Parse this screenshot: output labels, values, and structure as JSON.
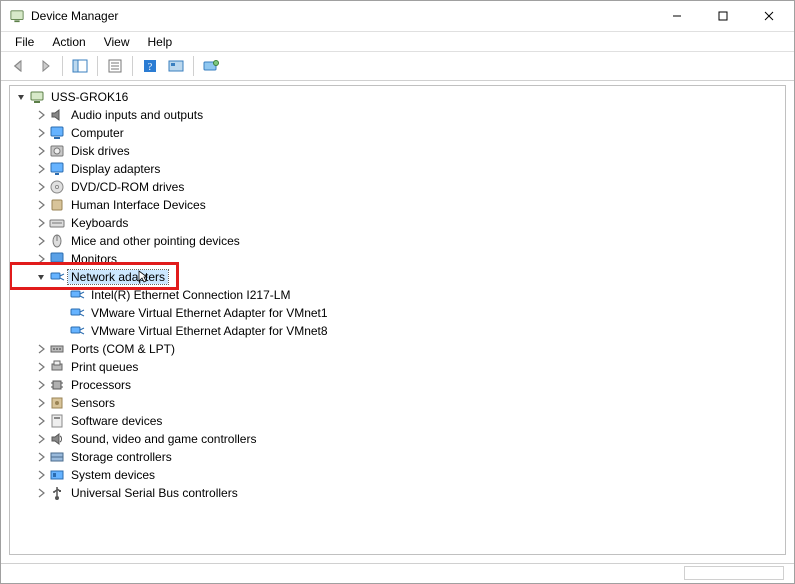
{
  "window": {
    "title": "Device Manager"
  },
  "menu": {
    "file": "File",
    "action": "Action",
    "view": "View",
    "help": "Help"
  },
  "tree": {
    "root": {
      "label": "USS-GROK16",
      "icon": "computer",
      "expanded": true
    },
    "categories": [
      {
        "label": "Audio inputs and outputs",
        "icon": "audio",
        "expanded": false
      },
      {
        "label": "Computer",
        "icon": "computer-monitor",
        "expanded": false
      },
      {
        "label": "Disk drives",
        "icon": "disk",
        "expanded": false
      },
      {
        "label": "Display adapters",
        "icon": "display",
        "expanded": false
      },
      {
        "label": "DVD/CD-ROM drives",
        "icon": "cd",
        "expanded": false
      },
      {
        "label": "Human Interface Devices",
        "icon": "hid",
        "expanded": false
      },
      {
        "label": "Keyboards",
        "icon": "keyboard",
        "expanded": false
      },
      {
        "label": "Mice and other pointing devices",
        "icon": "mouse",
        "expanded": false
      },
      {
        "label": "Monitors",
        "icon": "monitor",
        "expanded": false
      },
      {
        "label": "Network adapters",
        "icon": "network",
        "expanded": true,
        "selected": true,
        "highlighted": true,
        "children": [
          {
            "label": "Intel(R) Ethernet Connection I217-LM",
            "icon": "network"
          },
          {
            "label": "VMware Virtual Ethernet Adapter for VMnet1",
            "icon": "network"
          },
          {
            "label": "VMware Virtual Ethernet Adapter for VMnet8",
            "icon": "network"
          }
        ]
      },
      {
        "label": "Ports (COM & LPT)",
        "icon": "port",
        "expanded": false
      },
      {
        "label": "Print queues",
        "icon": "printer",
        "expanded": false
      },
      {
        "label": "Processors",
        "icon": "processor",
        "expanded": false
      },
      {
        "label": "Sensors",
        "icon": "sensor",
        "expanded": false
      },
      {
        "label": "Software devices",
        "icon": "software",
        "expanded": false
      },
      {
        "label": "Sound, video and game controllers",
        "icon": "sound",
        "expanded": false
      },
      {
        "label": "Storage controllers",
        "icon": "storage",
        "expanded": false
      },
      {
        "label": "System devices",
        "icon": "system",
        "expanded": false
      },
      {
        "label": "Universal Serial Bus controllers",
        "icon": "usb",
        "expanded": false
      }
    ]
  }
}
